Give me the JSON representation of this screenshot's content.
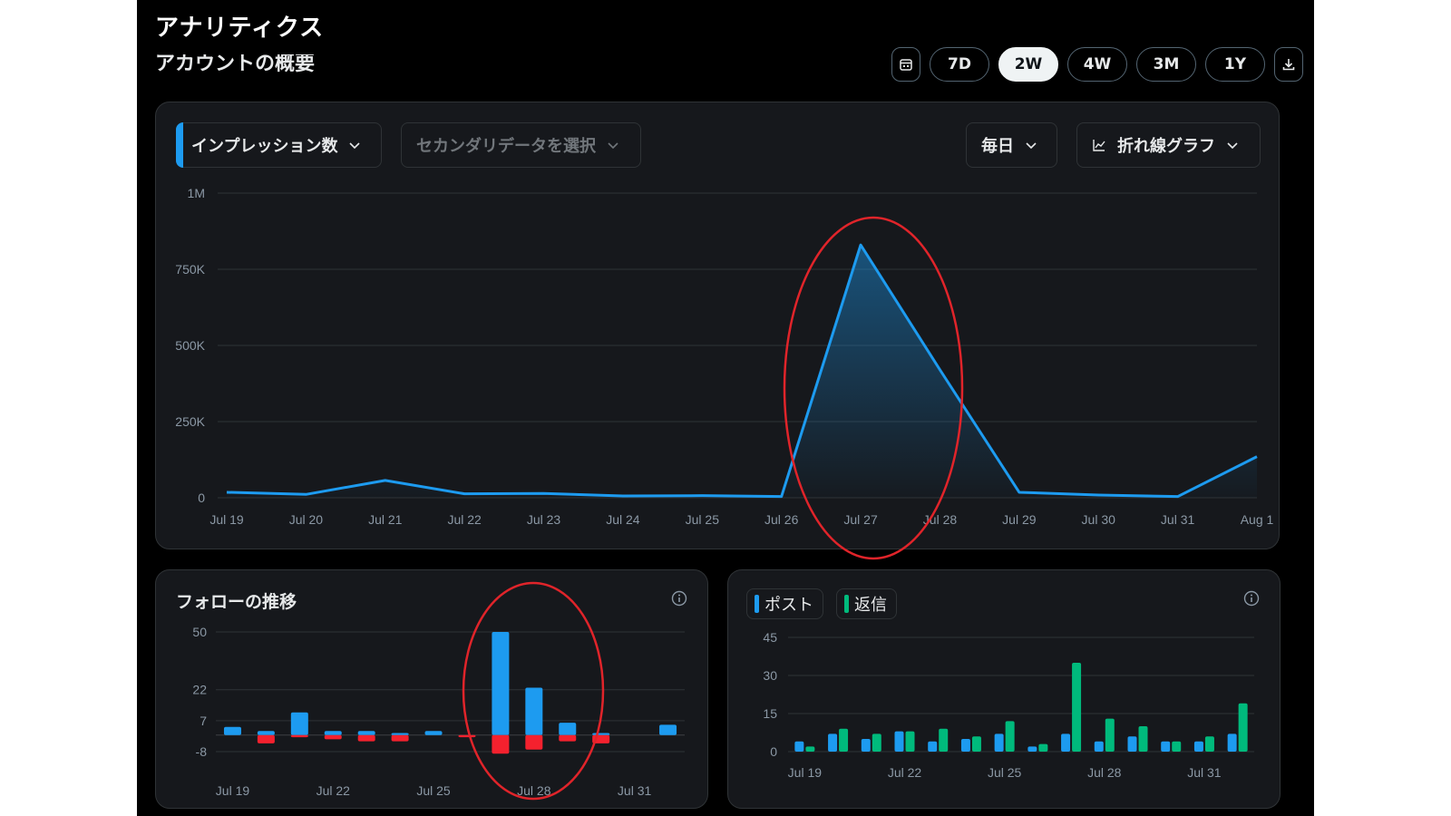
{
  "page": {
    "title": "アナリティクス",
    "section_title": "アカウントの概要"
  },
  "range_buttons": [
    {
      "label": "7D",
      "active": false
    },
    {
      "label": "2W",
      "active": true
    },
    {
      "label": "4W",
      "active": false
    },
    {
      "label": "3M",
      "active": false
    },
    {
      "label": "1Y",
      "active": false
    }
  ],
  "main_chart": {
    "primary_metric": "インプレッション数",
    "secondary_metric_placeholder": "セカンダリデータを選択",
    "interval": "毎日",
    "chart_type_label": "折れ線グラフ"
  },
  "follow_card": {
    "title": "フォローの推移"
  },
  "posts_card": {
    "legend": [
      {
        "label": "ポスト",
        "color": "#1d9bf0"
      },
      {
        "label": "返信",
        "color": "#00ba7c"
      }
    ]
  },
  "colors": {
    "accent_blue": "#1d9bf0",
    "accent_green": "#00ba7c",
    "negative_red": "#f4212e",
    "highlight_circle": "#e0242a"
  },
  "chart_data": [
    {
      "type": "area",
      "x": [
        "Jul 19",
        "Jul 20",
        "Jul 21",
        "Jul 22",
        "Jul 23",
        "Jul 24",
        "Jul 25",
        "Jul 26",
        "Jul 27",
        "Jul 28",
        "Jul 29",
        "Jul 30",
        "Jul 31",
        "Aug 1"
      ],
      "series": [
        {
          "values": [
            18000,
            11000,
            57000,
            13000,
            14000,
            6000,
            7000,
            4000,
            830000,
            420000,
            18000,
            9000,
            4000,
            135000
          ]
        }
      ],
      "y_ticks": [
        "0",
        "250K",
        "500K",
        "750K",
        "1M"
      ],
      "ylim": [
        0,
        1000000
      ],
      "grid": true
    },
    {
      "type": "bar",
      "x": [
        "Jul 19",
        "Jul 20",
        "Jul 21",
        "Jul 22",
        "Jul 23",
        "Jul 24",
        "Jul 25",
        "Jul 26",
        "Jul 27",
        "Jul 28",
        "Jul 29",
        "Jul 30",
        "Jul 31",
        "Aug 1"
      ],
      "x_tick_labels": [
        "Jul 19",
        "Jul 22",
        "Jul 25",
        "Jul 28",
        "Jul 31"
      ],
      "series": [
        {
          "values": [
            4,
            2,
            11,
            2,
            2,
            1,
            2,
            0,
            50,
            23,
            6,
            1,
            0,
            5
          ]
        },
        {
          "values": [
            0,
            -4,
            -1,
            -2,
            -3,
            -3,
            0,
            -1,
            -9,
            -7,
            -3,
            -4,
            0,
            0
          ]
        }
      ],
      "y_ticks": [
        "-8",
        "7",
        "22",
        "50"
      ],
      "ylim": [
        -8,
        50
      ],
      "grid": true
    },
    {
      "type": "bar",
      "x": [
        "Jul 19",
        "Jul 20",
        "Jul 21",
        "Jul 22",
        "Jul 23",
        "Jul 24",
        "Jul 25",
        "Jul 26",
        "Jul 27",
        "Jul 28",
        "Jul 29",
        "Jul 30",
        "Jul 31",
        "Aug 1"
      ],
      "x_tick_labels": [
        "Jul 19",
        "Jul 22",
        "Jul 25",
        "Jul 28",
        "Jul 31"
      ],
      "series": [
        {
          "name": "ポスト",
          "values": [
            4,
            7,
            5,
            8,
            4,
            5,
            7,
            2,
            7,
            4,
            6,
            4,
            4,
            7
          ]
        },
        {
          "name": "返信",
          "values": [
            2,
            9,
            7,
            8,
            9,
            6,
            12,
            3,
            35,
            13,
            10,
            4,
            6,
            19
          ]
        }
      ],
      "y_ticks": [
        "0",
        "15",
        "30",
        "45"
      ],
      "ylim": [
        0,
        45
      ],
      "grid": true
    }
  ]
}
